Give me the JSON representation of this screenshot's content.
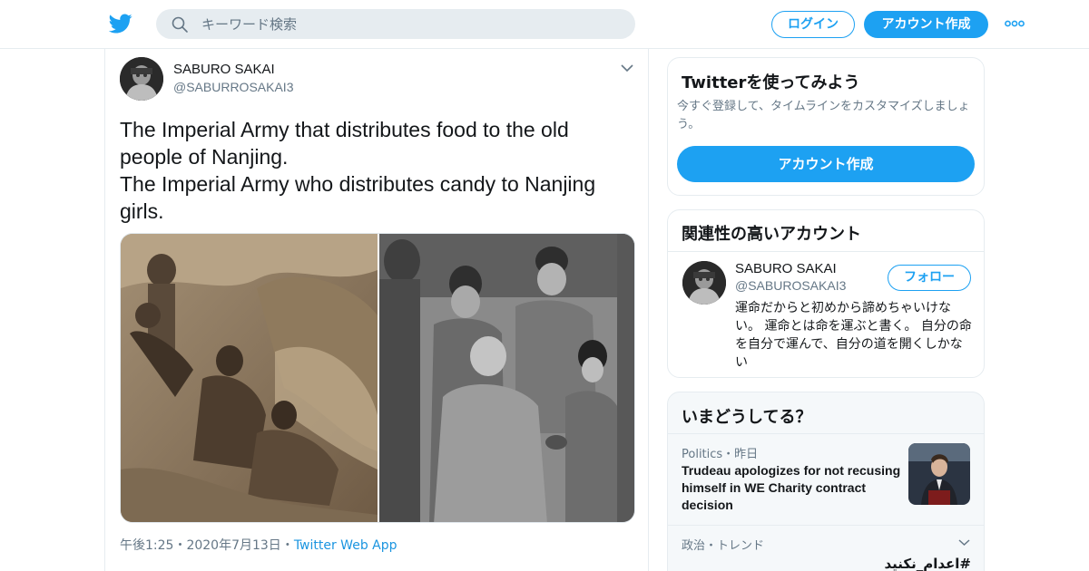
{
  "header": {
    "logo_icon": "twitter-bird-icon",
    "search_placeholder": "キーワード検索",
    "login_label": "ログイン",
    "signup_label": "アカウント作成",
    "more_icon": "more-dots-icon",
    "brand_color": "#1da1f2"
  },
  "tweet": {
    "author_name": "SABURO SAKAI",
    "author_handle": "@SABURROSAKAI3",
    "text_line1": "The Imperial Army that distributes food to the old people of Nanjing.",
    "text_line2": "The Imperial Army who distributes candy to Nanjing girls.",
    "time": "午後1:25",
    "date": "2020年7月13日",
    "app": "Twitter Web App",
    "separator": "・"
  },
  "join_card": {
    "title": "Twitterを使ってみよう",
    "subtitle": "今すぐ登録して、タイムラインをカスタマイズしましょう。",
    "button_label": "アカウント作成"
  },
  "related_card": {
    "title": "関連性の高いアカウント",
    "name": "SABURO SAKAI",
    "handle": "@SABUROSAKAI3",
    "follow_label": "フォロー",
    "bio": "運命だからと初めから諦めちゃいけない。 運命とは命を運ぶと書く。 自分の命を自分で運んで、自分の道を開くしかない"
  },
  "trends_card": {
    "title": "いまどうしてる？",
    "items": [
      {
        "category": "Politics・昨日",
        "title": "Trudeau apologizes for not recusing himself in WE Charity contract decision"
      },
      {
        "category": "政治・トレンド",
        "title": "#اعدام_نکنید"
      }
    ]
  }
}
